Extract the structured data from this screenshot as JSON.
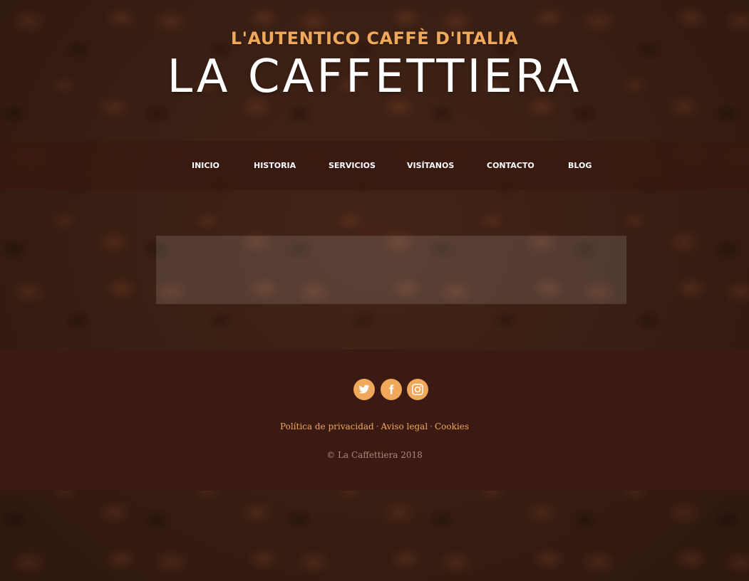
{
  "header": {
    "tagline": "L'AUTENTICO CAFFÈ D'ITALIA",
    "title": "LA CAFFETTIERA"
  },
  "nav": {
    "items": [
      {
        "label": "INICIO"
      },
      {
        "label": "HISTORIA"
      },
      {
        "label": "SERVICIOS"
      },
      {
        "label": "VISÍTANOS"
      },
      {
        "label": "CONTACTO"
      },
      {
        "label": "BLOG"
      }
    ]
  },
  "footer": {
    "social": [
      {
        "icon": "twitter-icon"
      },
      {
        "icon": "facebook-icon"
      },
      {
        "icon": "instagram-icon"
      }
    ],
    "links": {
      "privacy": "Política de privacidad",
      "legal": "Aviso legal",
      "cookies": "Cookies",
      "separator": "·"
    },
    "copyright": "© La Caffettiera 2018"
  },
  "colors": {
    "accent": "#f0a85a",
    "nav_bg": "#381a10",
    "footer_bg": "#3a1a12",
    "title": "#ffffff"
  }
}
